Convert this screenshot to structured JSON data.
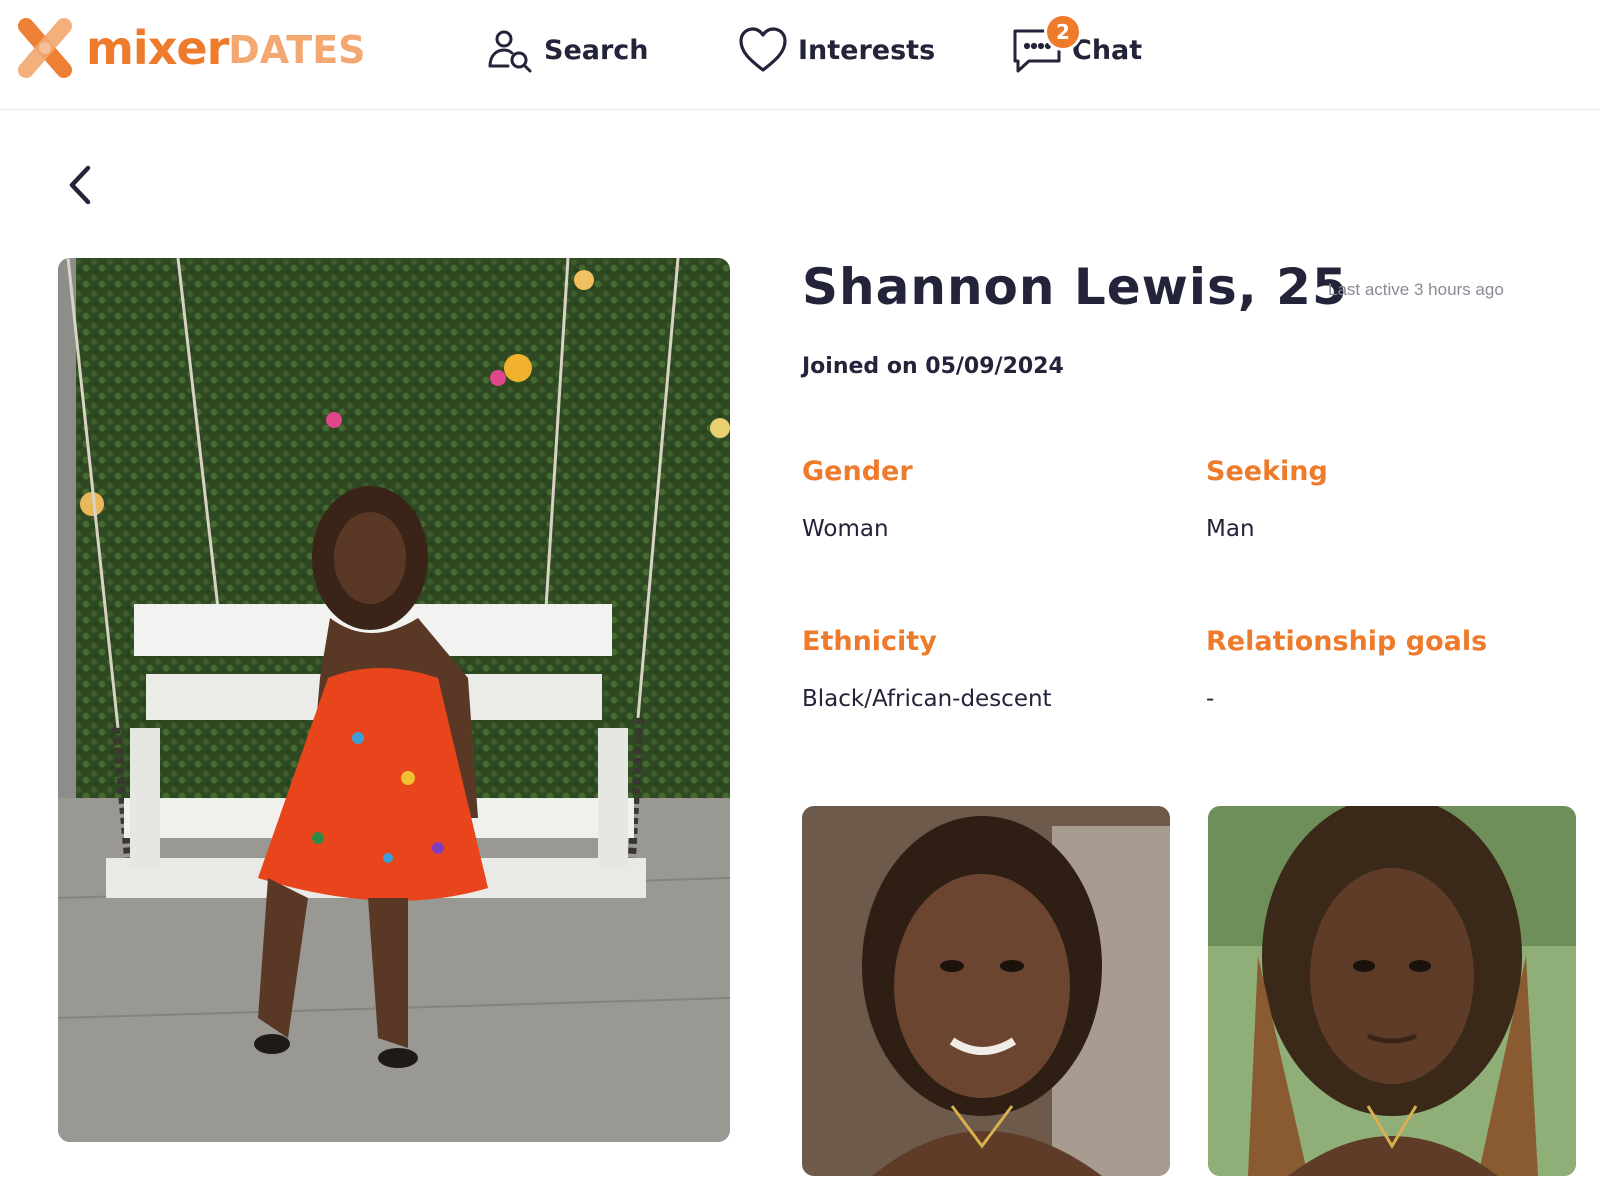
{
  "brand": {
    "name_part1": "mixer",
    "name_part2": "DATES",
    "primary_color": "#ee7a2c",
    "secondary_color": "#f2a870"
  },
  "nav": {
    "search_label": "Search",
    "interests_label": "Interests",
    "chat_label": "Chat",
    "chat_badge": "2"
  },
  "profile": {
    "name_age": "Shannon Lewis, 25",
    "last_active": "Last active 3 hours ago",
    "joined": "Joined on 05/09/2024",
    "attributes": {
      "gender_label": "Gender",
      "gender_value": "Woman",
      "seeking_label": "Seeking",
      "seeking_value": "Man",
      "ethnicity_label": "Ethnicity",
      "ethnicity_value": "Black/African-descent",
      "goals_label": "Relationship goals",
      "goals_value": "-"
    },
    "photos": [
      "main-photo",
      "thumbnail-photo-1",
      "thumbnail-photo-2"
    ]
  },
  "icons": {
    "back": "chevron-left-icon",
    "search": "user-search-icon",
    "interests": "heart-icon",
    "chat": "chat-bubble-icon"
  }
}
